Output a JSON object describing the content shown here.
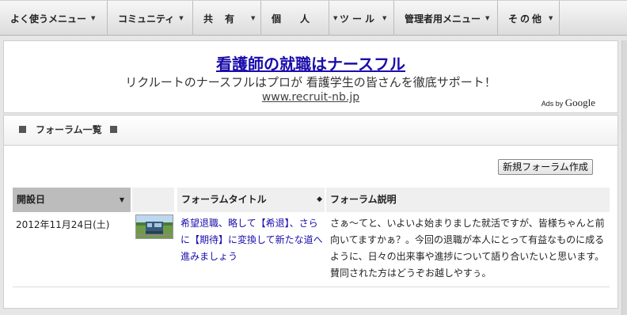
{
  "menu": [
    {
      "label": "よく使うメニュー"
    },
    {
      "label": "コミュニティ"
    },
    {
      "label": "共有"
    },
    {
      "label": "個人"
    },
    {
      "label": "ツール"
    },
    {
      "label": "管理者用メニュー"
    },
    {
      "label": "その他"
    }
  ],
  "ad": {
    "title": "看護師の就職はナースフル",
    "description": "リクルートのナースフルはプロが 看護学生の皆さんを徹底サポート！",
    "url": "www.recruit-nb.jp",
    "ads_by": "Ads by",
    "google": "Google"
  },
  "forum": {
    "heading": "フォーラム一覧",
    "new_button": "新規フォーラム作成",
    "columns": {
      "date": "開設日",
      "title": "フォーラムタイトル",
      "description": "フォーラム説明"
    },
    "rows": [
      {
        "date": "2012年11月24日(土)",
        "title": "希望退職、略して【希退】、さらに【期待】に変換して新たな道へ進みましょう",
        "description": "さぁ～てと、いよいよ始まりました就活ですが、皆様ちゃんと前向いてますかぁ？。今回の退職が本人にとって有益なものに成るように、日々の出来事や進捗について語り合いたいと思います。賛同された方はどうぞお越しやすぅ。"
      }
    ]
  },
  "icons": {
    "caret": "chevron-down-icon",
    "sort": "sort-icon"
  }
}
